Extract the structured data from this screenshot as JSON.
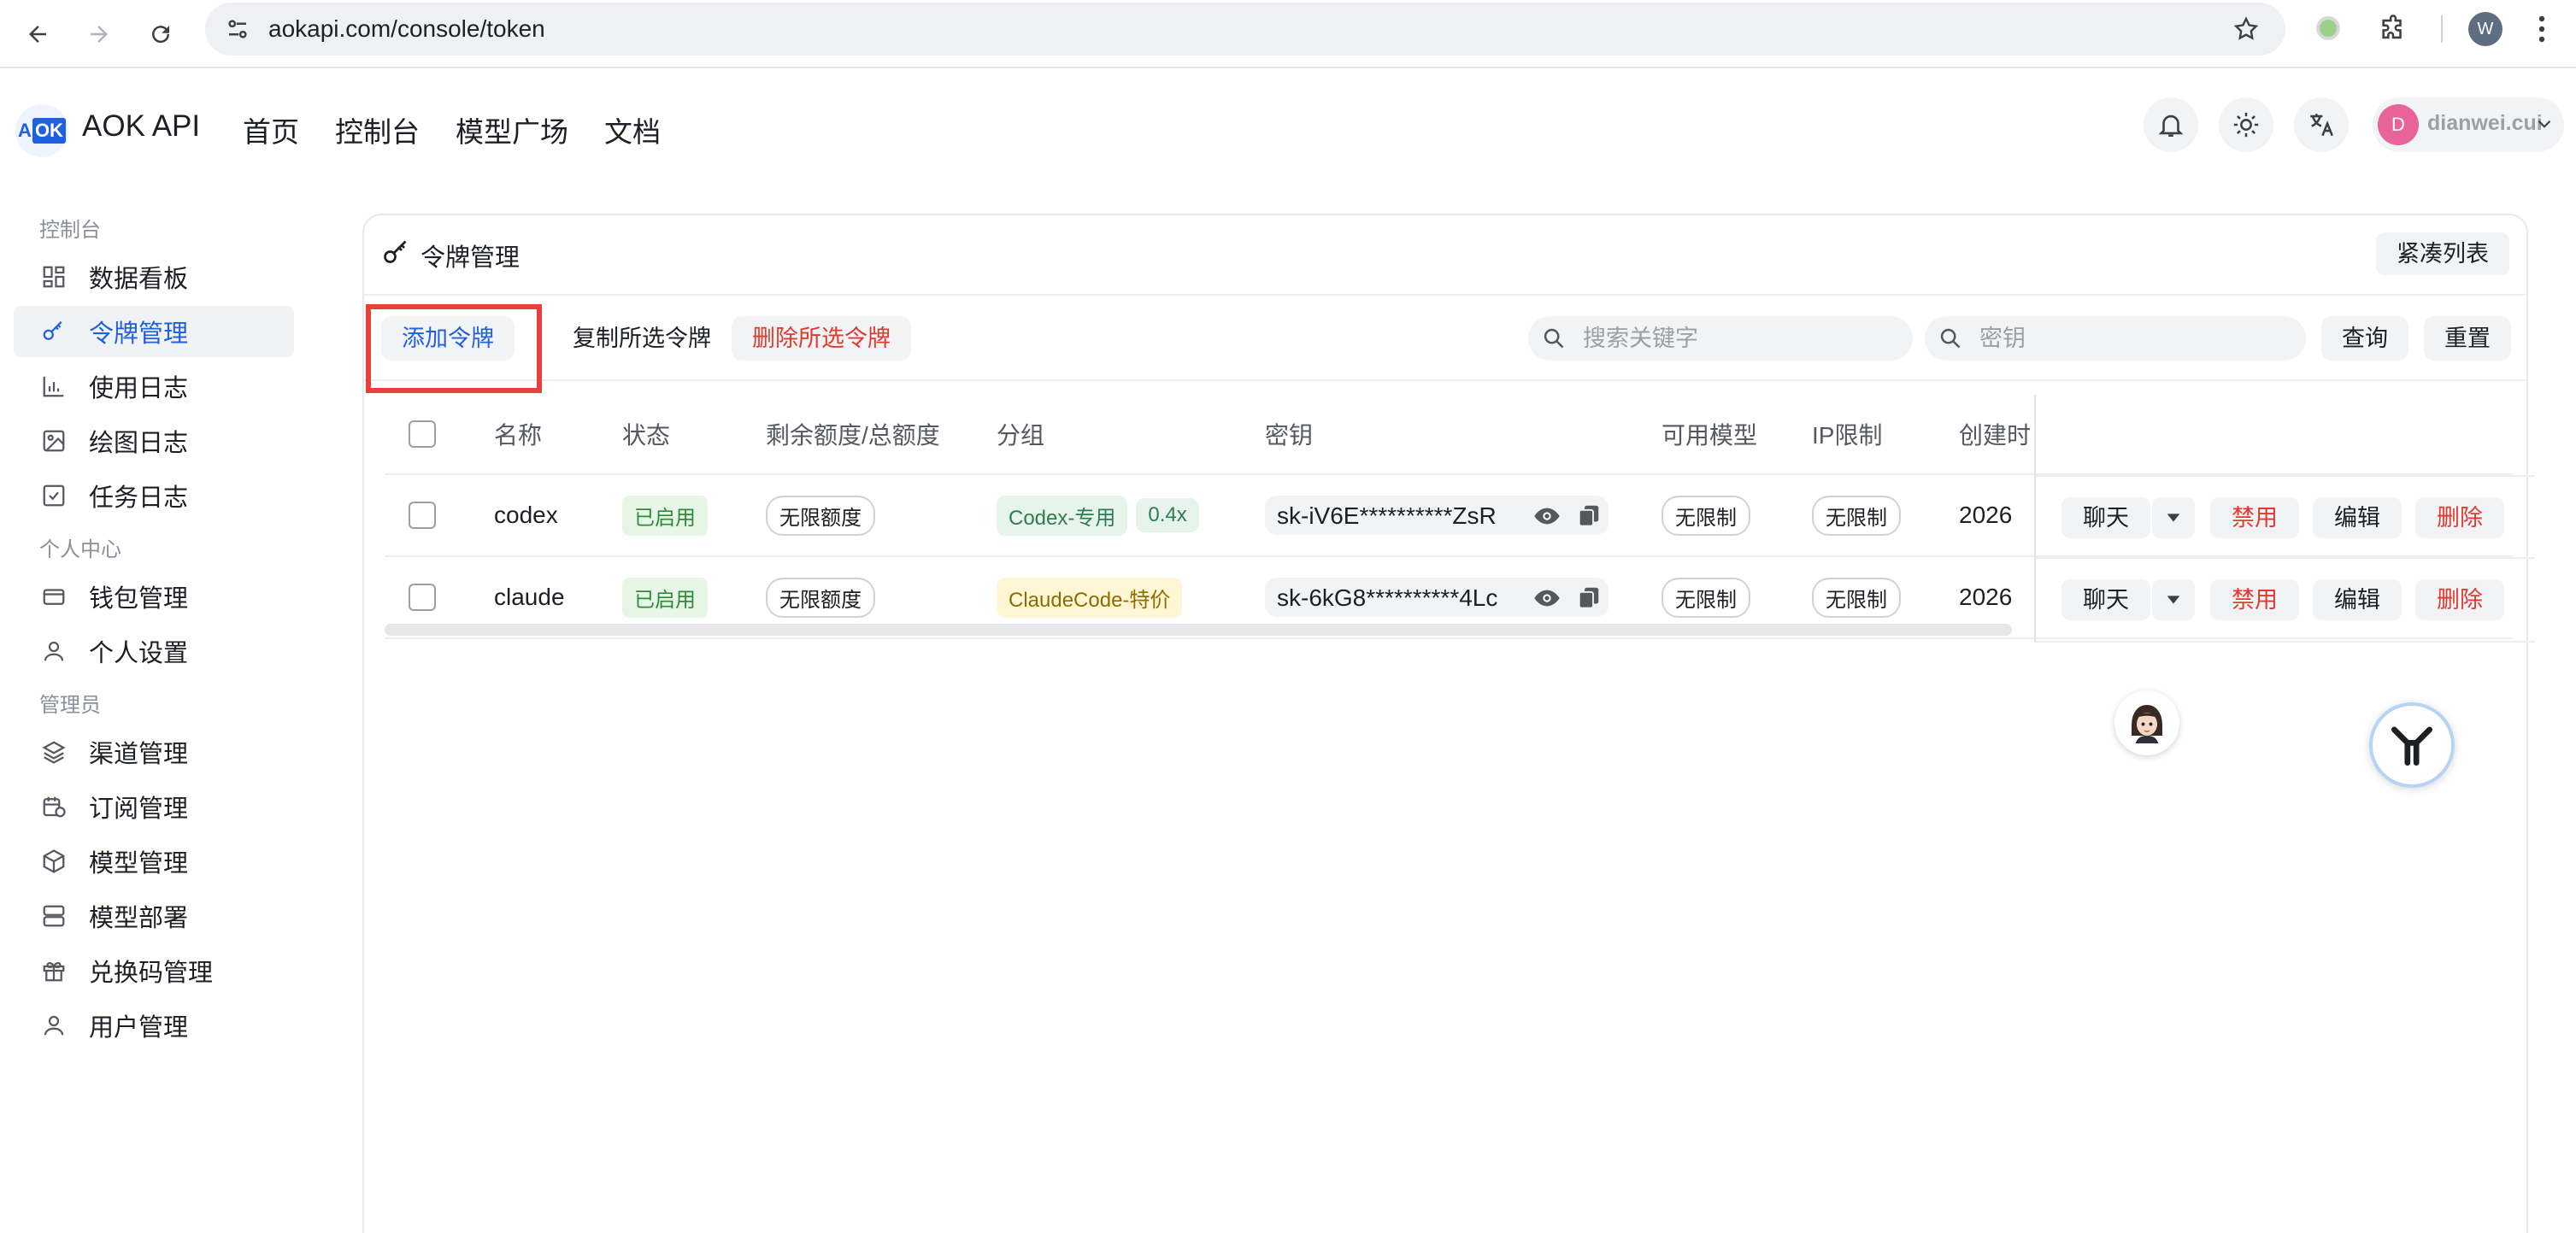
{
  "browser": {
    "url": "aokapi.com/console/token",
    "profile_initial": "W"
  },
  "header": {
    "logo_a": "A",
    "logo_ok": "OK",
    "brand": "AOK API",
    "nav": [
      "首页",
      "控制台",
      "模型广场",
      "文档"
    ],
    "user_initial": "D",
    "user_name": "dianwei.cui"
  },
  "sidebar": {
    "groups": [
      {
        "label": "控制台",
        "items": [
          {
            "label": "数据看板",
            "icon": "dashboard-icon"
          },
          {
            "label": "令牌管理",
            "icon": "key-icon",
            "active": true
          },
          {
            "label": "使用日志",
            "icon": "bar-chart-icon"
          },
          {
            "label": "绘图日志",
            "icon": "image-icon"
          },
          {
            "label": "任务日志",
            "icon": "checkbox-icon"
          }
        ]
      },
      {
        "label": "个人中心",
        "items": [
          {
            "label": "钱包管理",
            "icon": "wallet-icon"
          },
          {
            "label": "个人设置",
            "icon": "user-icon"
          }
        ]
      },
      {
        "label": "管理员",
        "items": [
          {
            "label": "渠道管理",
            "icon": "layers-icon"
          },
          {
            "label": "订阅管理",
            "icon": "calendar-clock-icon"
          },
          {
            "label": "模型管理",
            "icon": "cube-icon"
          },
          {
            "label": "模型部署",
            "icon": "server-icon"
          },
          {
            "label": "兑换码管理",
            "icon": "gift-icon"
          },
          {
            "label": "用户管理",
            "icon": "user-icon"
          }
        ]
      }
    ]
  },
  "card": {
    "title": "令牌管理",
    "compact_btn": "紧凑列表"
  },
  "toolbar": {
    "add": "添加令牌",
    "copy_selected": "复制所选令牌",
    "delete_selected": "删除所选令牌",
    "search_placeholder": "搜索关键字",
    "key_placeholder": "密钥",
    "query": "查询",
    "reset": "重置"
  },
  "table": {
    "columns": [
      "名称",
      "状态",
      "剩余额度/总额度",
      "分组",
      "密钥",
      "可用模型",
      "IP限制",
      "创建时"
    ],
    "rows": [
      {
        "name": "codex",
        "status": "已启用",
        "quota": "无限额度",
        "group": "Codex-专用",
        "ratio": "0.4x",
        "key": "sk-iV6E**********ZsR",
        "models": "无限制",
        "ip": "无限制",
        "created": "2026"
      },
      {
        "name": "claude",
        "status": "已启用",
        "quota": "无限额度",
        "group": "ClaudeCode-特价",
        "ratio": "",
        "key": "sk-6kG8**********4Lc",
        "models": "无限制",
        "ip": "无限制",
        "created": "2026"
      }
    ],
    "actions": {
      "chat": "聊天",
      "disable": "禁用",
      "edit": "编辑",
      "delete": "删除"
    }
  },
  "colors": {
    "accent": "#1f5fe0",
    "danger": "#e03a2f",
    "highlight": "#e8403a"
  }
}
